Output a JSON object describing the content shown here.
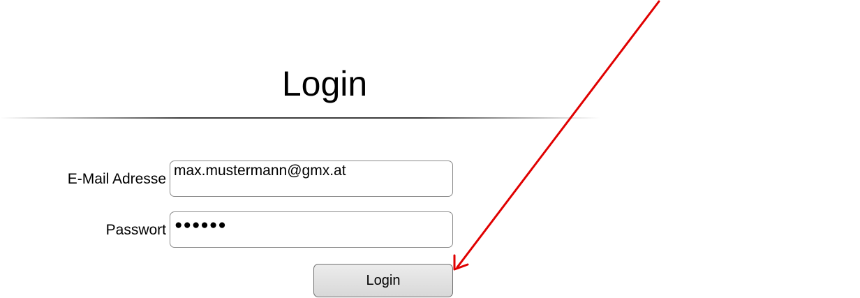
{
  "page": {
    "title": "Login"
  },
  "form": {
    "email_label": "E-Mail Adresse",
    "email_value": "max.mustermann@gmx.at",
    "password_label": "Passwort",
    "password_mask": "●●●●●●",
    "submit_label": "Login"
  },
  "annotation": {
    "arrow_color": "#e00000",
    "arrow_icon": "arrow-pointer-icon"
  }
}
